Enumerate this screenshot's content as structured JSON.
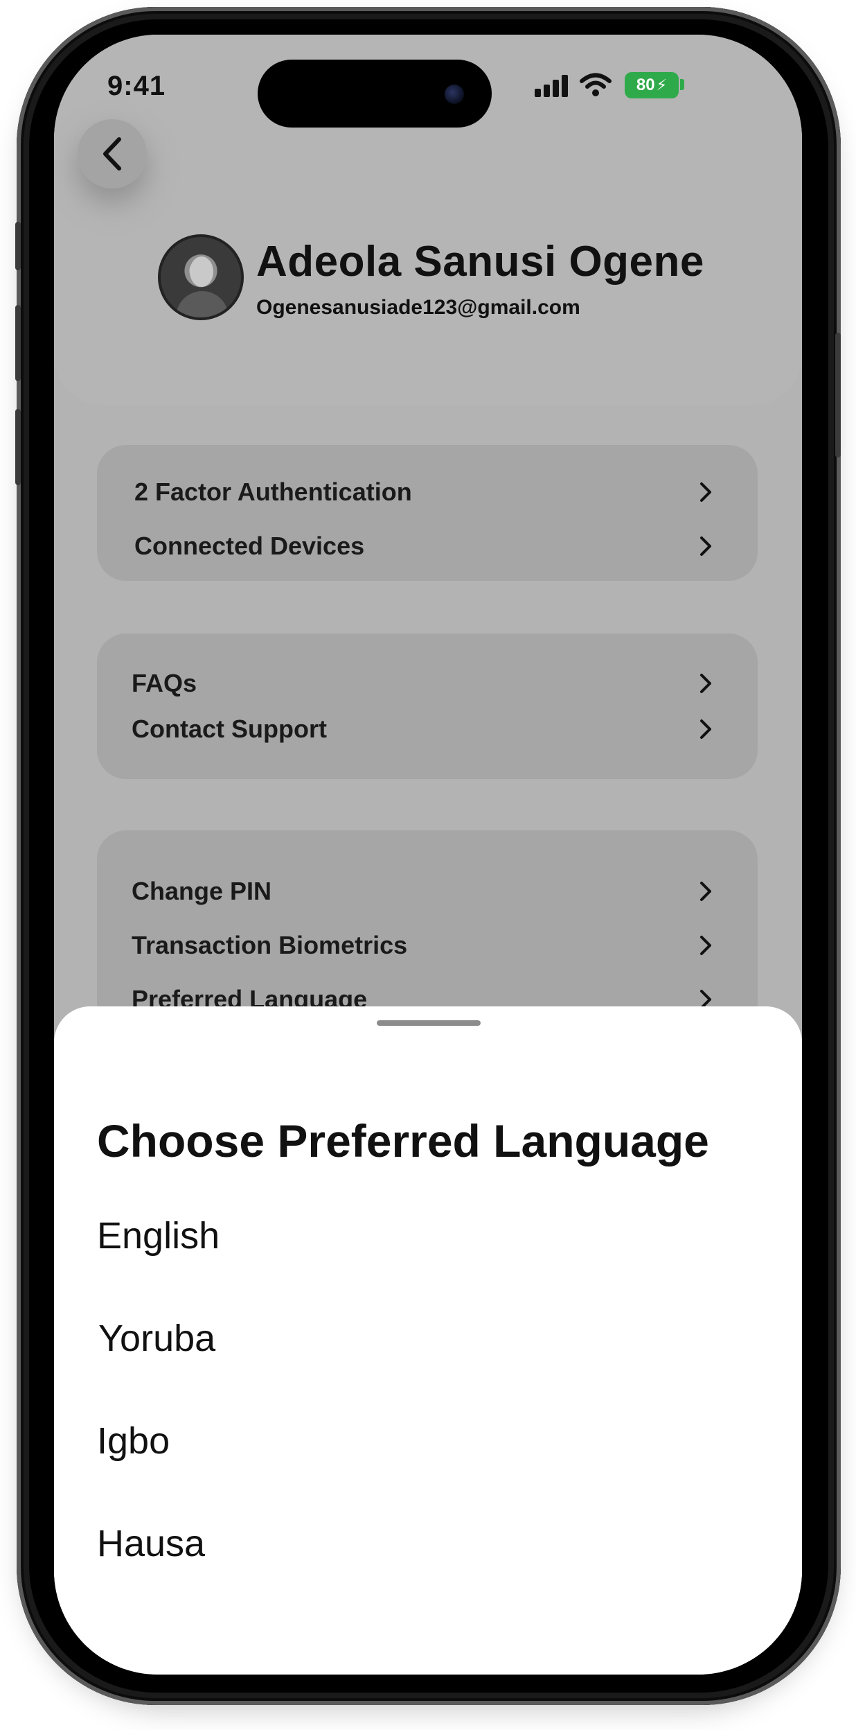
{
  "status_bar": {
    "time": "9:41",
    "battery": "80"
  },
  "profile": {
    "name": "Adeola Sanusi Ogene",
    "email": "Ogenesanusiade123@gmail.com"
  },
  "groups": [
    {
      "items": [
        {
          "label": "2 Factor Authentication"
        },
        {
          "label": "Connected Devices"
        }
      ]
    },
    {
      "items": [
        {
          "label": "FAQs"
        },
        {
          "label": "Contact Support"
        }
      ]
    },
    {
      "items": [
        {
          "label": "Change PIN"
        },
        {
          "label": "Transaction Biometrics"
        },
        {
          "label": "Preferred Language"
        }
      ]
    }
  ],
  "sheet": {
    "title": "Choose Preferred Language",
    "languages": [
      "English",
      "Yoruba",
      "Igbo",
      "Hausa"
    ]
  },
  "colors": {
    "overlay_gray": "#b3b3b3",
    "card_gray": "#a6a6a6",
    "battery_green": "#2faa4a",
    "sheet_bg": "#ffffff"
  },
  "icons": [
    "back-icon",
    "chevron-right-icon",
    "signal-icon",
    "wifi-icon",
    "battery-icon"
  ]
}
